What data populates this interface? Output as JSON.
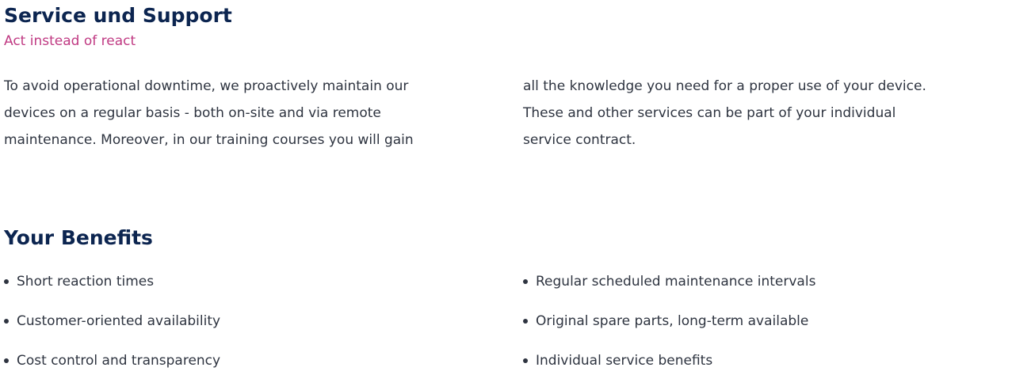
{
  "service_section": {
    "title": "Service und Support",
    "subtitle": "Act instead of react",
    "intro_left": [
      "To avoid operational downtime, we proactively maintain our",
      "devices on a regular basis - both on-site and via remote",
      "maintenance. Moreover, in our training courses you will gain"
    ],
    "intro_right": [
      "all the knowledge you need for a proper use of your device.",
      "These and other services can be part of your individual",
      "service contract."
    ]
  },
  "benefits_section": {
    "title": "Your Benefits",
    "left_items": [
      "Short reaction times",
      "Customer-oriented availability",
      "Cost control and transparency"
    ],
    "right_items": [
      "Regular scheduled maintenance intervals",
      "Original spare parts, long-term available",
      "Individual service benefits"
    ]
  },
  "colors": {
    "heading": "#0c2550",
    "subtitle_accent": "#c03a83",
    "body_text": "#2e3440"
  }
}
